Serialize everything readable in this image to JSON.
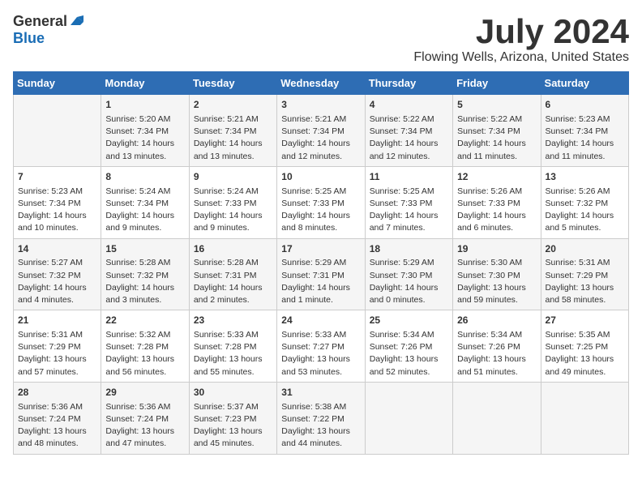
{
  "header": {
    "logo_general": "General",
    "logo_blue": "Blue",
    "month_title": "July 2024",
    "location": "Flowing Wells, Arizona, United States"
  },
  "days_of_week": [
    "Sunday",
    "Monday",
    "Tuesday",
    "Wednesday",
    "Thursday",
    "Friday",
    "Saturday"
  ],
  "weeks": [
    [
      {
        "day": "",
        "info": ""
      },
      {
        "day": "1",
        "info": "Sunrise: 5:20 AM\nSunset: 7:34 PM\nDaylight: 14 hours\nand 13 minutes."
      },
      {
        "day": "2",
        "info": "Sunrise: 5:21 AM\nSunset: 7:34 PM\nDaylight: 14 hours\nand 13 minutes."
      },
      {
        "day": "3",
        "info": "Sunrise: 5:21 AM\nSunset: 7:34 PM\nDaylight: 14 hours\nand 12 minutes."
      },
      {
        "day": "4",
        "info": "Sunrise: 5:22 AM\nSunset: 7:34 PM\nDaylight: 14 hours\nand 12 minutes."
      },
      {
        "day": "5",
        "info": "Sunrise: 5:22 AM\nSunset: 7:34 PM\nDaylight: 14 hours\nand 11 minutes."
      },
      {
        "day": "6",
        "info": "Sunrise: 5:23 AM\nSunset: 7:34 PM\nDaylight: 14 hours\nand 11 minutes."
      }
    ],
    [
      {
        "day": "7",
        "info": "Sunrise: 5:23 AM\nSunset: 7:34 PM\nDaylight: 14 hours\nand 10 minutes."
      },
      {
        "day": "8",
        "info": "Sunrise: 5:24 AM\nSunset: 7:34 PM\nDaylight: 14 hours\nand 9 minutes."
      },
      {
        "day": "9",
        "info": "Sunrise: 5:24 AM\nSunset: 7:33 PM\nDaylight: 14 hours\nand 9 minutes."
      },
      {
        "day": "10",
        "info": "Sunrise: 5:25 AM\nSunset: 7:33 PM\nDaylight: 14 hours\nand 8 minutes."
      },
      {
        "day": "11",
        "info": "Sunrise: 5:25 AM\nSunset: 7:33 PM\nDaylight: 14 hours\nand 7 minutes."
      },
      {
        "day": "12",
        "info": "Sunrise: 5:26 AM\nSunset: 7:33 PM\nDaylight: 14 hours\nand 6 minutes."
      },
      {
        "day": "13",
        "info": "Sunrise: 5:26 AM\nSunset: 7:32 PM\nDaylight: 14 hours\nand 5 minutes."
      }
    ],
    [
      {
        "day": "14",
        "info": "Sunrise: 5:27 AM\nSunset: 7:32 PM\nDaylight: 14 hours\nand 4 minutes."
      },
      {
        "day": "15",
        "info": "Sunrise: 5:28 AM\nSunset: 7:32 PM\nDaylight: 14 hours\nand 3 minutes."
      },
      {
        "day": "16",
        "info": "Sunrise: 5:28 AM\nSunset: 7:31 PM\nDaylight: 14 hours\nand 2 minutes."
      },
      {
        "day": "17",
        "info": "Sunrise: 5:29 AM\nSunset: 7:31 PM\nDaylight: 14 hours\nand 1 minute."
      },
      {
        "day": "18",
        "info": "Sunrise: 5:29 AM\nSunset: 7:30 PM\nDaylight: 14 hours\nand 0 minutes."
      },
      {
        "day": "19",
        "info": "Sunrise: 5:30 AM\nSunset: 7:30 PM\nDaylight: 13 hours\nand 59 minutes."
      },
      {
        "day": "20",
        "info": "Sunrise: 5:31 AM\nSunset: 7:29 PM\nDaylight: 13 hours\nand 58 minutes."
      }
    ],
    [
      {
        "day": "21",
        "info": "Sunrise: 5:31 AM\nSunset: 7:29 PM\nDaylight: 13 hours\nand 57 minutes."
      },
      {
        "day": "22",
        "info": "Sunrise: 5:32 AM\nSunset: 7:28 PM\nDaylight: 13 hours\nand 56 minutes."
      },
      {
        "day": "23",
        "info": "Sunrise: 5:33 AM\nSunset: 7:28 PM\nDaylight: 13 hours\nand 55 minutes."
      },
      {
        "day": "24",
        "info": "Sunrise: 5:33 AM\nSunset: 7:27 PM\nDaylight: 13 hours\nand 53 minutes."
      },
      {
        "day": "25",
        "info": "Sunrise: 5:34 AM\nSunset: 7:26 PM\nDaylight: 13 hours\nand 52 minutes."
      },
      {
        "day": "26",
        "info": "Sunrise: 5:34 AM\nSunset: 7:26 PM\nDaylight: 13 hours\nand 51 minutes."
      },
      {
        "day": "27",
        "info": "Sunrise: 5:35 AM\nSunset: 7:25 PM\nDaylight: 13 hours\nand 49 minutes."
      }
    ],
    [
      {
        "day": "28",
        "info": "Sunrise: 5:36 AM\nSunset: 7:24 PM\nDaylight: 13 hours\nand 48 minutes."
      },
      {
        "day": "29",
        "info": "Sunrise: 5:36 AM\nSunset: 7:24 PM\nDaylight: 13 hours\nand 47 minutes."
      },
      {
        "day": "30",
        "info": "Sunrise: 5:37 AM\nSunset: 7:23 PM\nDaylight: 13 hours\nand 45 minutes."
      },
      {
        "day": "31",
        "info": "Sunrise: 5:38 AM\nSunset: 7:22 PM\nDaylight: 13 hours\nand 44 minutes."
      },
      {
        "day": "",
        "info": ""
      },
      {
        "day": "",
        "info": ""
      },
      {
        "day": "",
        "info": ""
      }
    ]
  ]
}
